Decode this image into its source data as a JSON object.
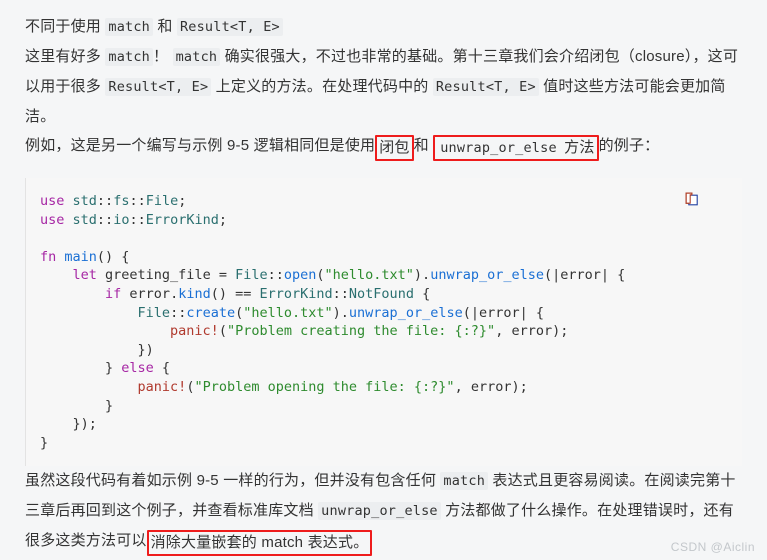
{
  "document": {
    "background_color": "#f5f6f7",
    "watermark": "CSDN @Aiclin"
  },
  "paragraphs": {
    "p1": {
      "seg1": "不同于使用 ",
      "code1": "match",
      "seg2": " 和 ",
      "code2": "Result<T, E>"
    },
    "p2": {
      "seg1": "这里有好多 ",
      "code1": "match",
      "seg2": "！ ",
      "code2": "match",
      "seg3": " 确实很强大，不过也非常的基础。第十三章我们会介绍闭包（closure），这可以用于很多 ",
      "code3": "Result<T, E>",
      "seg4": " 上定义的方法。在处理代码中的 ",
      "code4": "Result<T, E>",
      "seg5": " 值时这些方法可能会更加简洁。"
    },
    "p3": {
      "seg1": "例如，这是另一个编写与示例 9-5 逻辑相同但是使用",
      "hl1": "闭包",
      "seg2": "和 ",
      "hl2_code": "unwrap_or_else",
      "hl2_text": " 方法",
      "seg3": "的例子："
    },
    "p4": {
      "seg1": "虽然这段代码有着如示例 9-5 一样的行为，但并没有包含任何 ",
      "code1": "match",
      "seg2": " 表达式且更容易阅读。在阅读完第十三章后再回到这个例子，并查看标准库文档 ",
      "code2": "unwrap_or_else",
      "seg3": " 方法都做了什么操作。在处理错误时，还有很多这类方法可以",
      "hl1": "消除大量嵌套的 match 表达式。"
    }
  },
  "code_block": {
    "language": "rust",
    "copy_icon": "copy-icon",
    "copy_label": "复制代码",
    "lines": [
      [
        {
          "t": "use",
          "c": "k"
        },
        {
          "t": " ",
          "c": "pn"
        },
        {
          "t": "std",
          "c": "ty"
        },
        {
          "t": "::",
          "c": "pn"
        },
        {
          "t": "fs",
          "c": "ty"
        },
        {
          "t": "::",
          "c": "pn"
        },
        {
          "t": "File",
          "c": "ty"
        },
        {
          "t": ";",
          "c": "pn"
        }
      ],
      [
        {
          "t": "use",
          "c": "k"
        },
        {
          "t": " ",
          "c": "pn"
        },
        {
          "t": "std",
          "c": "ty"
        },
        {
          "t": "::",
          "c": "pn"
        },
        {
          "t": "io",
          "c": "ty"
        },
        {
          "t": "::",
          "c": "pn"
        },
        {
          "t": "ErrorKind",
          "c": "ty"
        },
        {
          "t": ";",
          "c": "pn"
        }
      ],
      [],
      [
        {
          "t": "fn",
          "c": "k"
        },
        {
          "t": " ",
          "c": "pn"
        },
        {
          "t": "main",
          "c": "fnm"
        },
        {
          "t": "() {",
          "c": "pn"
        }
      ],
      [
        {
          "t": "    ",
          "c": "pn"
        },
        {
          "t": "let",
          "c": "k"
        },
        {
          "t": " greeting_file = ",
          "c": "pn"
        },
        {
          "t": "File",
          "c": "ty"
        },
        {
          "t": "::",
          "c": "pn"
        },
        {
          "t": "open",
          "c": "fnm"
        },
        {
          "t": "(",
          "c": "pn"
        },
        {
          "t": "\"hello.txt\"",
          "c": "st"
        },
        {
          "t": ").",
          "c": "pn"
        },
        {
          "t": "unwrap_or_else",
          "c": "fnm"
        },
        {
          "t": "(|error| {",
          "c": "pn"
        }
      ],
      [
        {
          "t": "        ",
          "c": "pn"
        },
        {
          "t": "if",
          "c": "k"
        },
        {
          "t": " error.",
          "c": "pn"
        },
        {
          "t": "kind",
          "c": "fnm"
        },
        {
          "t": "() == ",
          "c": "pn"
        },
        {
          "t": "ErrorKind",
          "c": "ty"
        },
        {
          "t": "::",
          "c": "pn"
        },
        {
          "t": "NotFound",
          "c": "ty"
        },
        {
          "t": " {",
          "c": "pn"
        }
      ],
      [
        {
          "t": "            ",
          "c": "pn"
        },
        {
          "t": "File",
          "c": "ty"
        },
        {
          "t": "::",
          "c": "pn"
        },
        {
          "t": "create",
          "c": "fnm"
        },
        {
          "t": "(",
          "c": "pn"
        },
        {
          "t": "\"hello.txt\"",
          "c": "st"
        },
        {
          "t": ").",
          "c": "pn"
        },
        {
          "t": "unwrap_or_else",
          "c": "fnm"
        },
        {
          "t": "(|error| {",
          "c": "pn"
        }
      ],
      [
        {
          "t": "                ",
          "c": "pn"
        },
        {
          "t": "panic!",
          "c": "mac"
        },
        {
          "t": "(",
          "c": "pn"
        },
        {
          "t": "\"Problem creating the file: {:?}\"",
          "c": "st"
        },
        {
          "t": ", error);",
          "c": "pn"
        }
      ],
      [
        {
          "t": "            })",
          "c": "pn"
        }
      ],
      [
        {
          "t": "        } ",
          "c": "pn"
        },
        {
          "t": "else",
          "c": "k"
        },
        {
          "t": " {",
          "c": "pn"
        }
      ],
      [
        {
          "t": "            ",
          "c": "pn"
        },
        {
          "t": "panic!",
          "c": "mac"
        },
        {
          "t": "(",
          "c": "pn"
        },
        {
          "t": "\"Problem opening the file: {:?}\"",
          "c": "st"
        },
        {
          "t": ", error);",
          "c": "pn"
        }
      ],
      [
        {
          "t": "        }",
          "c": "pn"
        }
      ],
      [
        {
          "t": "    });",
          "c": "pn"
        }
      ],
      [
        {
          "t": "}",
          "c": "pn"
        }
      ]
    ]
  },
  "colors": {
    "keyword": "#a626a4",
    "function": "#1a6fd4",
    "type": "#2a6f6f",
    "string": "#2e8b2e",
    "macro": "#b03a2e",
    "highlight_box": "#ee1c1c",
    "code_bg": "#f7f7f7",
    "inline_code_bg": "#eceef0"
  }
}
